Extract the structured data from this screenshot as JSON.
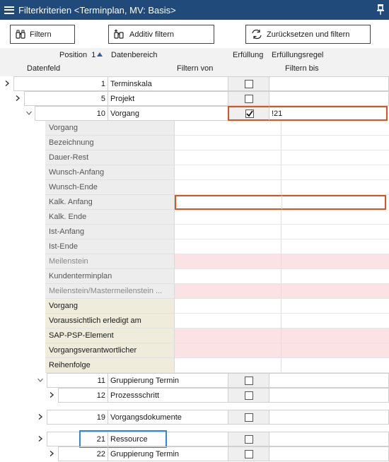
{
  "window": {
    "title": "Filterkriterien <Terminplan, MV: Basis>"
  },
  "toolbar": {
    "filter_label": "Filtern",
    "additive_label": "Additiv filtern",
    "reset_label": "Zurücksetzen und filtern"
  },
  "columns": {
    "position": "Position",
    "position_sort_index": "1",
    "datenbereich": "Datenbereich",
    "erfuellung": "Erfüllung",
    "erfuellungsregel": "Erfüllungsregel",
    "datenfeld": "Datenfeld",
    "filtern_von": "Filtern von",
    "filtern_bis": "Filtern bis"
  },
  "tree": [
    {
      "position": "1",
      "name": "Terminskala",
      "checked": false,
      "rule": ""
    },
    {
      "position": "5",
      "name": "Projekt",
      "checked": false,
      "rule": ""
    },
    {
      "position": "10",
      "name": "Vorgang",
      "checked": true,
      "rule": "!21"
    },
    {
      "position": "11",
      "name": "Gruppierung Termin",
      "checked": false,
      "rule": ""
    },
    {
      "position": "12",
      "name": "Prozessschritt",
      "checked": false,
      "rule": ""
    },
    {
      "position": "19",
      "name": "Vorgangsdokumente",
      "checked": false,
      "rule": ""
    },
    {
      "position": "21",
      "name": "Ressource",
      "checked": false,
      "rule": ""
    },
    {
      "position": "22",
      "name": "Gruppierung Termin",
      "checked": false,
      "rule": ""
    }
  ],
  "fields": [
    {
      "label": "Vorgang",
      "von": "",
      "bis": ""
    },
    {
      "label": "Bezeichnung",
      "von": "",
      "bis": ""
    },
    {
      "label": "Dauer-Rest",
      "von": "",
      "bis": ""
    },
    {
      "label": "Wunsch-Anfang",
      "von": "",
      "bis": ""
    },
    {
      "label": "Wunsch-Ende",
      "von": "",
      "bis": ""
    },
    {
      "label": "Kalk. Anfang",
      "von": "",
      "bis": ""
    },
    {
      "label": "Kalk. Ende",
      "von": "",
      "bis": ""
    },
    {
      "label": "Ist-Anfang",
      "von": "",
      "bis": ""
    },
    {
      "label": "Ist-Ende",
      "von": "",
      "bis": ""
    },
    {
      "label": "Meilenstein",
      "von": "",
      "bis": ""
    },
    {
      "label": "Kundenterminplan",
      "von": "",
      "bis": ""
    },
    {
      "label": "Meilenstein/Mastermeilenstein ...",
      "von": "",
      "bis": ""
    },
    {
      "label": "Vorgang",
      "von": "",
      "bis": ""
    },
    {
      "label": "Voraussichtlich erledigt am",
      "von": "",
      "bis": ""
    },
    {
      "label": "SAP-PSP-Element",
      "von": "",
      "bis": ""
    },
    {
      "label": "Vorgangsverantwortlicher",
      "von": "",
      "bis": ""
    },
    {
      "label": "Reihenfolge",
      "von": "",
      "bis": ""
    }
  ],
  "colors": {
    "titlebar": "#1f4a7a",
    "highlight_orange": "#d9541e",
    "focus_blue": "#2b8ad6",
    "required_pink": "#fbe3e5",
    "beige": "#f0ecdc"
  }
}
